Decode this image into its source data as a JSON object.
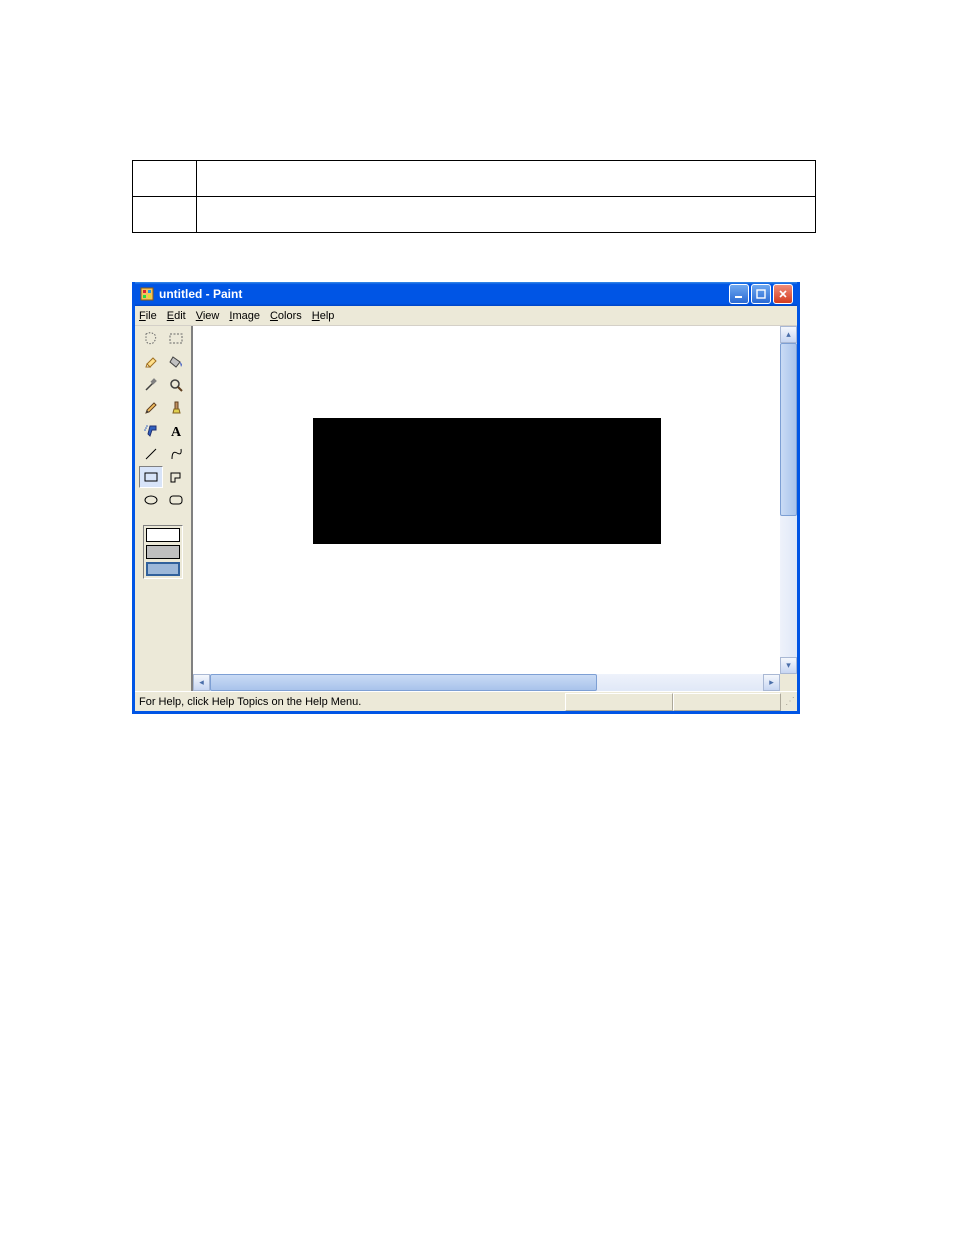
{
  "window": {
    "title": "untitled - Paint"
  },
  "menus": {
    "file": "File",
    "edit": "Edit",
    "view": "View",
    "image": "Image",
    "colors": "Colors",
    "help": "Help"
  },
  "status": {
    "help_text": "For Help, click Help Topics on the Help Menu."
  },
  "tools": {
    "freeform_select": "freeform-select",
    "rect_select": "rect-select",
    "eraser": "eraser",
    "fill": "fill",
    "picker": "picker",
    "magnifier": "magnifier",
    "pencil": "pencil",
    "brush": "brush",
    "airbrush": "airbrush",
    "text": "text",
    "line": "line",
    "curve": "curve",
    "rectangle": "rectangle",
    "polygon": "polygon",
    "ellipse": "ellipse",
    "rounded_rect": "rounded-rect"
  }
}
